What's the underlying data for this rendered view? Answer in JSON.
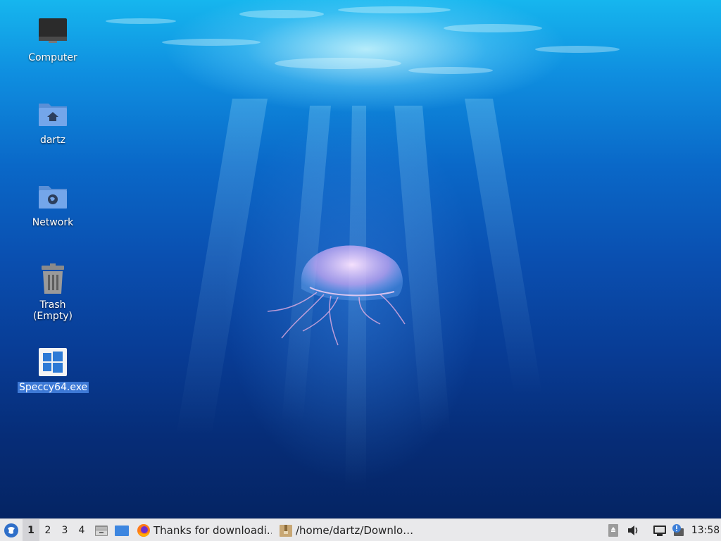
{
  "desktop": {
    "icons": [
      {
        "label": "Computer",
        "icon": "computer-icon"
      },
      {
        "label": "dartz",
        "icon": "home-folder-icon"
      },
      {
        "label": "Network",
        "icon": "network-folder-icon"
      },
      {
        "label": "Trash (Empty)",
        "icon": "trash-icon"
      },
      {
        "label": "Speccy64.exe",
        "icon": "windows-exe-icon",
        "selected": true
      }
    ]
  },
  "taskbar": {
    "menu_icon": "whisker-menu-icon",
    "workspaces": [
      "1",
      "2",
      "3",
      "4"
    ],
    "active_workspace": "1",
    "launchers": [
      "file-manager-icon",
      "show-desktop-icon"
    ],
    "tasks": [
      {
        "label": "Thanks for downloadi…",
        "icon": "firefox-icon"
      },
      {
        "label": "/home/dartz/Downlo…",
        "icon": "archive-manager-icon"
      }
    ],
    "tray": [
      "removable-drive-icon",
      "volume-icon",
      "network-icon",
      "notification-icon"
    ],
    "clock": "13:58"
  },
  "colors": {
    "selection": "#3d79d6",
    "panel": "#e9e9eb"
  }
}
